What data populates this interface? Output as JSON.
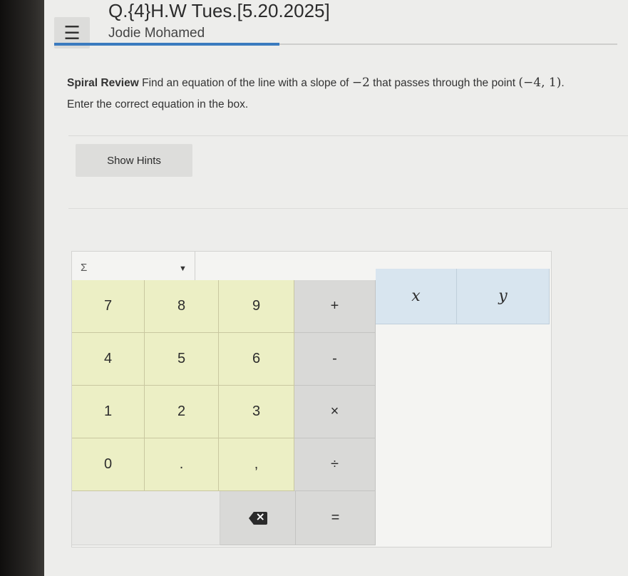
{
  "header": {
    "title": "Q.{4}H.W Tues.[5.20.2025]",
    "student_name": "Jodie Mohamed",
    "progress": 0.4
  },
  "question": {
    "label": "Spiral Review",
    "text": " Find an equation of the line with a slope of ",
    "slope": "−2",
    "text2": " that passes through the point ",
    "point": "(−4, 1)",
    "end": "."
  },
  "instruction": "Enter the correct equation in the box.",
  "hints": {
    "button_label": "Show Hints"
  },
  "keypad": {
    "toolbar_symbol": "Σ",
    "number_keys": [
      "7",
      "8",
      "9",
      "4",
      "5",
      "6",
      "1",
      "2",
      "3",
      "0",
      ".",
      ","
    ],
    "operator_keys": [
      "+",
      "-",
      "×",
      "÷",
      "="
    ],
    "variable_keys": [
      "x",
      "y"
    ]
  }
}
